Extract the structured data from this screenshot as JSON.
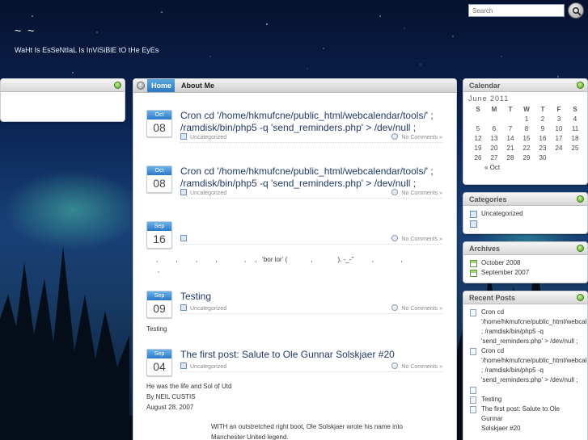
{
  "header": {
    "site_title": "~      ~",
    "tagline": "WaHt Is EsSeNtIaL Is InViSiBlE tO tHe EyEs",
    "search_placeholder": "Search",
    "search_button_icon": "magnifier-icon"
  },
  "left_widget": {
    "status_icon": "green-dot-icon"
  },
  "nav": {
    "home_icon": "circle-home-icon",
    "tabs": [
      {
        "label": "Home",
        "active": true
      },
      {
        "label": "About Me",
        "active": false
      }
    ]
  },
  "posts": [
    {
      "month": "Oct",
      "day": "08",
      "title": "Cron cd '/home/hkmufcne/public_html/webcalendar/tools/' ; /ramdisk/bin/php5 -q 'send_reminders.php' > /dev/null ;",
      "category": "Uncategorized",
      "comments": "No Comments »"
    },
    {
      "month": "Oct",
      "day": "08",
      "title": "Cron cd '/home/hkmufcne/public_html/webcalendar/tools/' ; /ramdisk/bin/php5 -q 'send_reminders.php' > /dev/null ;",
      "category": "Uncategorized",
      "comments": "No Comments »"
    },
    {
      "month": "Sep",
      "day": "16",
      "title": "",
      "category": "",
      "comments": "No Comments »",
      "excerpt_line1": ",          ,          ,          ,               ,     ,   ‘bor lor’ (             ,              ). -_-’’          ,               ,",
      "excerpt_line2": ","
    },
    {
      "month": "Sep",
      "day": "09",
      "title": "Testing",
      "category": "Uncategorized",
      "comments": "No Comments »",
      "excerpt": "Testing"
    },
    {
      "month": "Sep",
      "day": "04",
      "title": "The first post: Salute to Ole Gunnar Solskjaer #20",
      "category": "Uncategorized",
      "comments": "No Comments »",
      "excerpt_lines": [
        "He was the life and Sol of Utd",
        "By NEIL CUSTIS",
        "August 28, 2007"
      ],
      "body_line1": "WITH an outstretched right boot, Ole Solskjaer wrote his name into",
      "body_line2": "Manchester United legend."
    }
  ],
  "calendar": {
    "title": "Calendar",
    "month_label": "June 2011",
    "weekdays": [
      "S",
      "M",
      "T",
      "W",
      "T",
      "F",
      "S"
    ],
    "weeks": [
      [
        "",
        "",
        "",
        "1",
        "2",
        "3",
        "4"
      ],
      [
        "5",
        "6",
        "7",
        "8",
        "9",
        "10",
        "11"
      ],
      [
        "12",
        "13",
        "14",
        "15",
        "16",
        "17",
        "18"
      ],
      [
        "19",
        "20",
        "21",
        "22",
        "23",
        "24",
        "25"
      ],
      [
        "26",
        "27",
        "28",
        "29",
        "30",
        "",
        ""
      ]
    ],
    "prev_link": "« Oct"
  },
  "categories": {
    "title": "Categories",
    "items": [
      "Uncategorized",
      ""
    ]
  },
  "archives": {
    "title": "Archives",
    "items": [
      "October 2008",
      "September 2007"
    ]
  },
  "recent_posts": {
    "title": "Recent Posts",
    "items": [
      [
        "Cron cd",
        "'/home/hkmufcne/public_html/webcale",
        "; /ramdisk/bin/php5 -q",
        "'send_reminders.php' > /dev/null ;"
      ],
      [
        "Cron cd",
        "'/home/hkmufcne/public_html/webcale",
        "; /ramdisk/bin/php5 -q",
        "'send_reminders.php' > /dev/null ;"
      ],
      [
        ""
      ],
      [
        "Testing"
      ],
      [
        "The first post: Salute to Ole Gunnar",
        "Solskjaer #20"
      ]
    ]
  }
}
